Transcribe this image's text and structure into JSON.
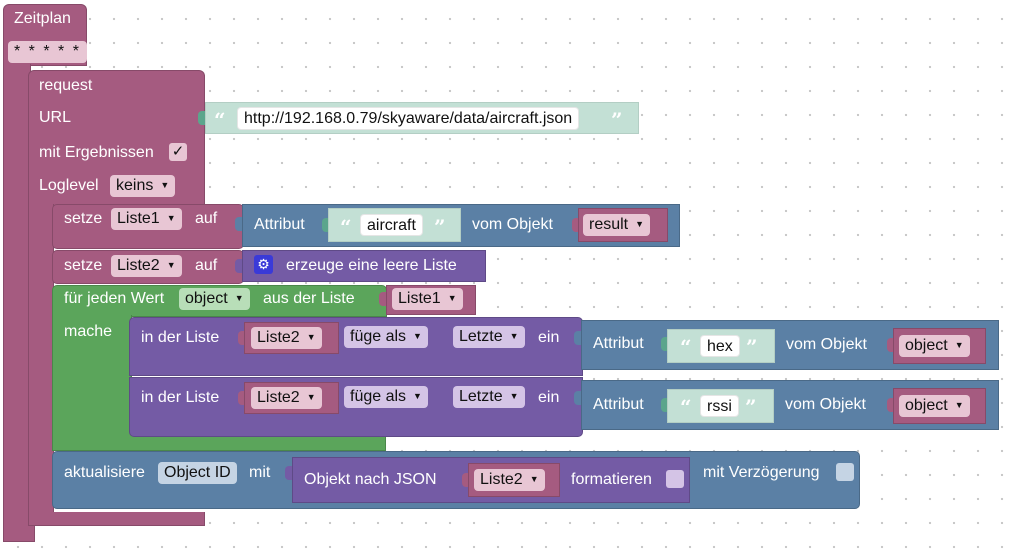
{
  "schedule": {
    "label": "Zeitplan",
    "value": "* * * * *"
  },
  "request": {
    "label": "request",
    "url_label": "URL",
    "url": "http://192.168.0.79/skyaware/data/aircraft.json",
    "with_results_label": "mit Ergebnissen",
    "with_results_check": "✓",
    "loglevel_label": "Loglevel",
    "loglevel_value": "keins"
  },
  "set1": {
    "set_label": "setze",
    "var": "Liste1",
    "to_label": "auf",
    "attr_label": "Attribut",
    "attr_value": "aircraft",
    "from_object_label": "vom Objekt",
    "object_var": "result"
  },
  "set2": {
    "set_label": "setze",
    "var": "Liste2",
    "to_label": "auf",
    "create_label": "erzeuge eine leere Liste"
  },
  "foreach": {
    "label": "für jeden Wert",
    "item_var": "object",
    "from_list_label": "aus der Liste",
    "list_var": "Liste1",
    "do_label": "mache"
  },
  "insert1": {
    "in_list_label": "in der Liste",
    "list_var": "Liste2",
    "mode": "füge als",
    "where": "Letzte",
    "in_label": "ein",
    "attr_label": "Attribut",
    "attr_value": "hex",
    "from_object_label": "vom Objekt",
    "object_var": "object"
  },
  "insert2": {
    "in_list_label": "in der Liste",
    "list_var": "Liste2",
    "mode": "füge als",
    "where": "Letzte",
    "in_label": "ein",
    "attr_label": "Attribut",
    "attr_value": "rssi",
    "from_object_label": "vom Objekt",
    "object_var": "object"
  },
  "update": {
    "label": "aktualisiere",
    "target": "Object ID",
    "with_label": "mit",
    "json_label": "Objekt nach JSON",
    "json_var": "Liste2",
    "format_label": "formatieren",
    "delay_label": "mit Verzögerung"
  },
  "colors": {
    "event": "#a55b80",
    "variables": "#a55b80",
    "loops": "#5ba55b",
    "lists": "#745ba5",
    "objects": "#5b80a5",
    "text": "#5ba58c"
  }
}
